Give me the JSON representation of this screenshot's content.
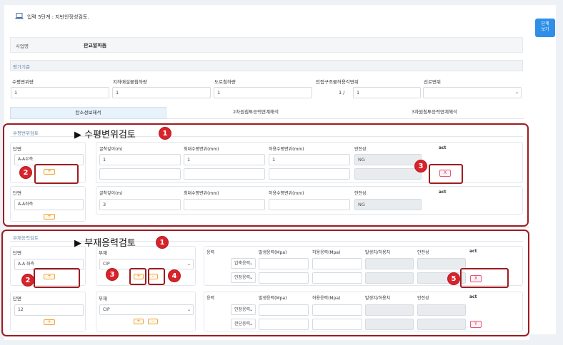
{
  "header": {
    "title": "입력 5단계 : 지반안정성검토."
  },
  "side_button": {
    "label": "단계\n보기"
  },
  "business": {
    "label": "사업명",
    "value": "판교알파돔"
  },
  "criteria": {
    "section_title": "평가기준",
    "fields": [
      {
        "label": "수평변위량",
        "value": "1"
      },
      {
        "label": "지하매설물침하량",
        "value": "1"
      },
      {
        "label": "도로침하량",
        "value": "1"
      },
      {
        "label": "인접구조물허용각변위",
        "prefix": "1 /",
        "value": "1"
      },
      {
        "label": "선로변위",
        "value": ""
      }
    ]
  },
  "tabs": [
    "탄소성보해석",
    "2차원침투응력연계해석",
    "3차원침투응력연계해석"
  ],
  "horizontal": {
    "section_title": "수평변위검토",
    "annotation": "▶ 수평변위검토",
    "headers": [
      "굴착깊이(m)",
      "최대수평변위(mm)",
      "허용수평변위(mm)",
      "안전성",
      "act"
    ],
    "blocks": [
      {
        "section_label": "단면",
        "section_name": "A-A우측",
        "add": "+",
        "rows": [
          [
            "1",
            "1",
            "1",
            "NG"
          ],
          [
            "",
            "",
            "",
            ""
          ]
        ],
        "act": "X"
      },
      {
        "section_label": "단면",
        "section_name": "A-A좌측",
        "add": "+",
        "rows": [
          [
            "3",
            "",
            "",
            "NG"
          ]
        ]
      }
    ]
  },
  "member": {
    "section_title": "부재응력검토",
    "annotation": "▶ 부재응력검토",
    "headers": [
      "응력",
      "발생응력(Mpa)",
      "허용응력(Mpa)",
      "발생치/허용치",
      "안전성",
      "act"
    ],
    "blocks": [
      {
        "section_label": "단면",
        "section_name": "A-A 좌측",
        "add": "+",
        "member_label": "부재",
        "member_value": "CIP",
        "stress_rows": [
          "압축응력",
          "인장응력"
        ],
        "act": "X"
      },
      {
        "section_label": "단면",
        "section_name": "12",
        "add": "+",
        "member_label": "부재",
        "member_value": "CIP",
        "stress_rows": [
          "인장응력",
          "전단응력"
        ],
        "act": "Y"
      }
    ],
    "add_btn": "+",
    "remove_btn": "-"
  },
  "markers": [
    "1",
    "2",
    "3",
    "1",
    "2",
    "3",
    "4",
    "5"
  ],
  "colors": {
    "marker": "#d9232b",
    "outline": "#9e1b1f",
    "orange": "#f0a43c"
  }
}
